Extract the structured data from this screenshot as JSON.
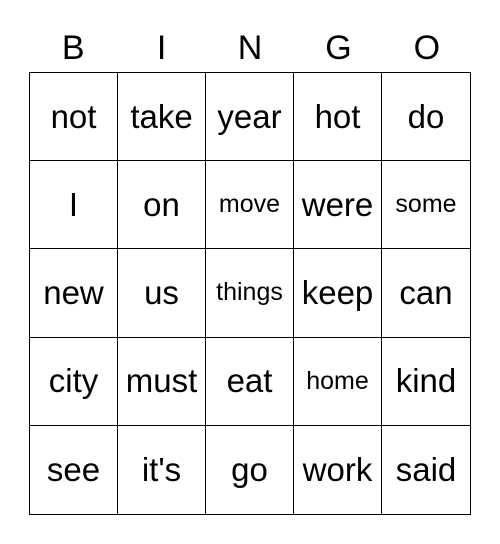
{
  "header": [
    "B",
    "I",
    "N",
    "G",
    "O"
  ],
  "cells": [
    [
      "not",
      "take",
      "year",
      "hot",
      "do"
    ],
    [
      "I",
      "on",
      "move",
      "were",
      "some"
    ],
    [
      "new",
      "us",
      "things",
      "keep",
      "can"
    ],
    [
      "city",
      "must",
      "eat",
      "home",
      "kind"
    ],
    [
      "see",
      "it's",
      "go",
      "work",
      "said"
    ]
  ]
}
